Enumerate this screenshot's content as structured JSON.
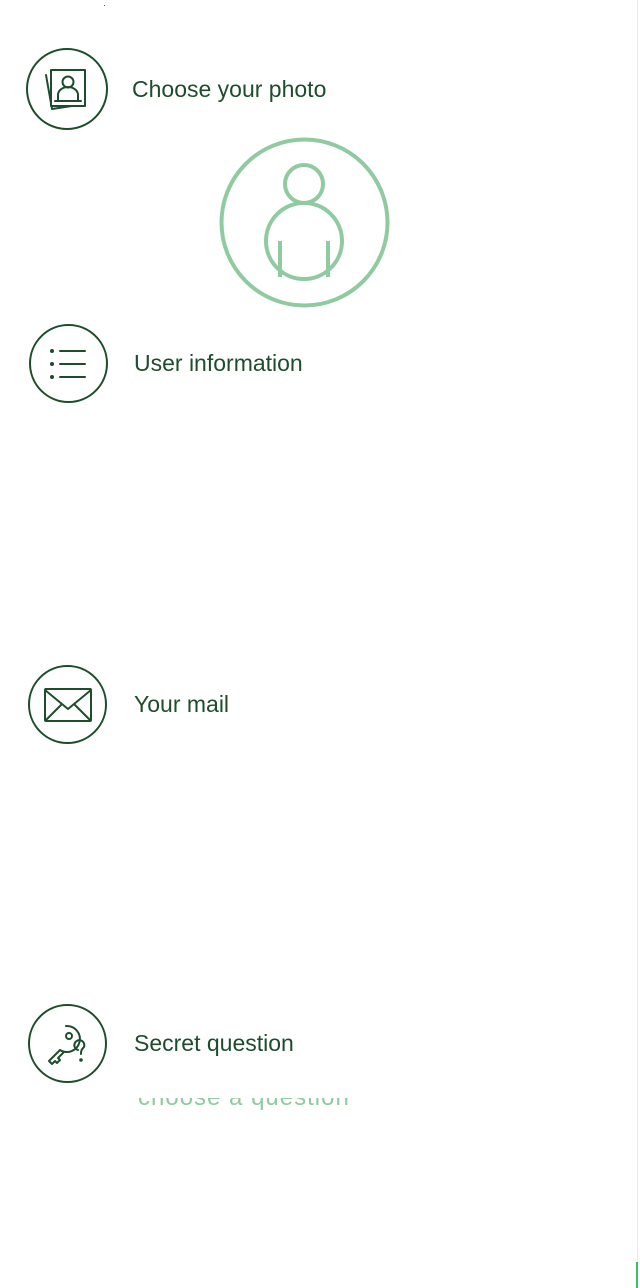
{
  "sections": {
    "photo": {
      "label": "Choose your photo",
      "icon": "photo-icon"
    },
    "user_info": {
      "label": "User information",
      "icon": "list-icon"
    },
    "mail": {
      "label": "Your mail",
      "icon": "envelope-icon"
    },
    "secret": {
      "label": "Secret question",
      "icon": "key-question-icon"
    }
  },
  "avatar": {
    "icon": "user-avatar-icon"
  },
  "secret_question_select": {
    "value": "choose a question"
  },
  "colors": {
    "primary": "#1d4d2c",
    "avatar": "#8fcaa0",
    "accent": "#35c06a"
  }
}
